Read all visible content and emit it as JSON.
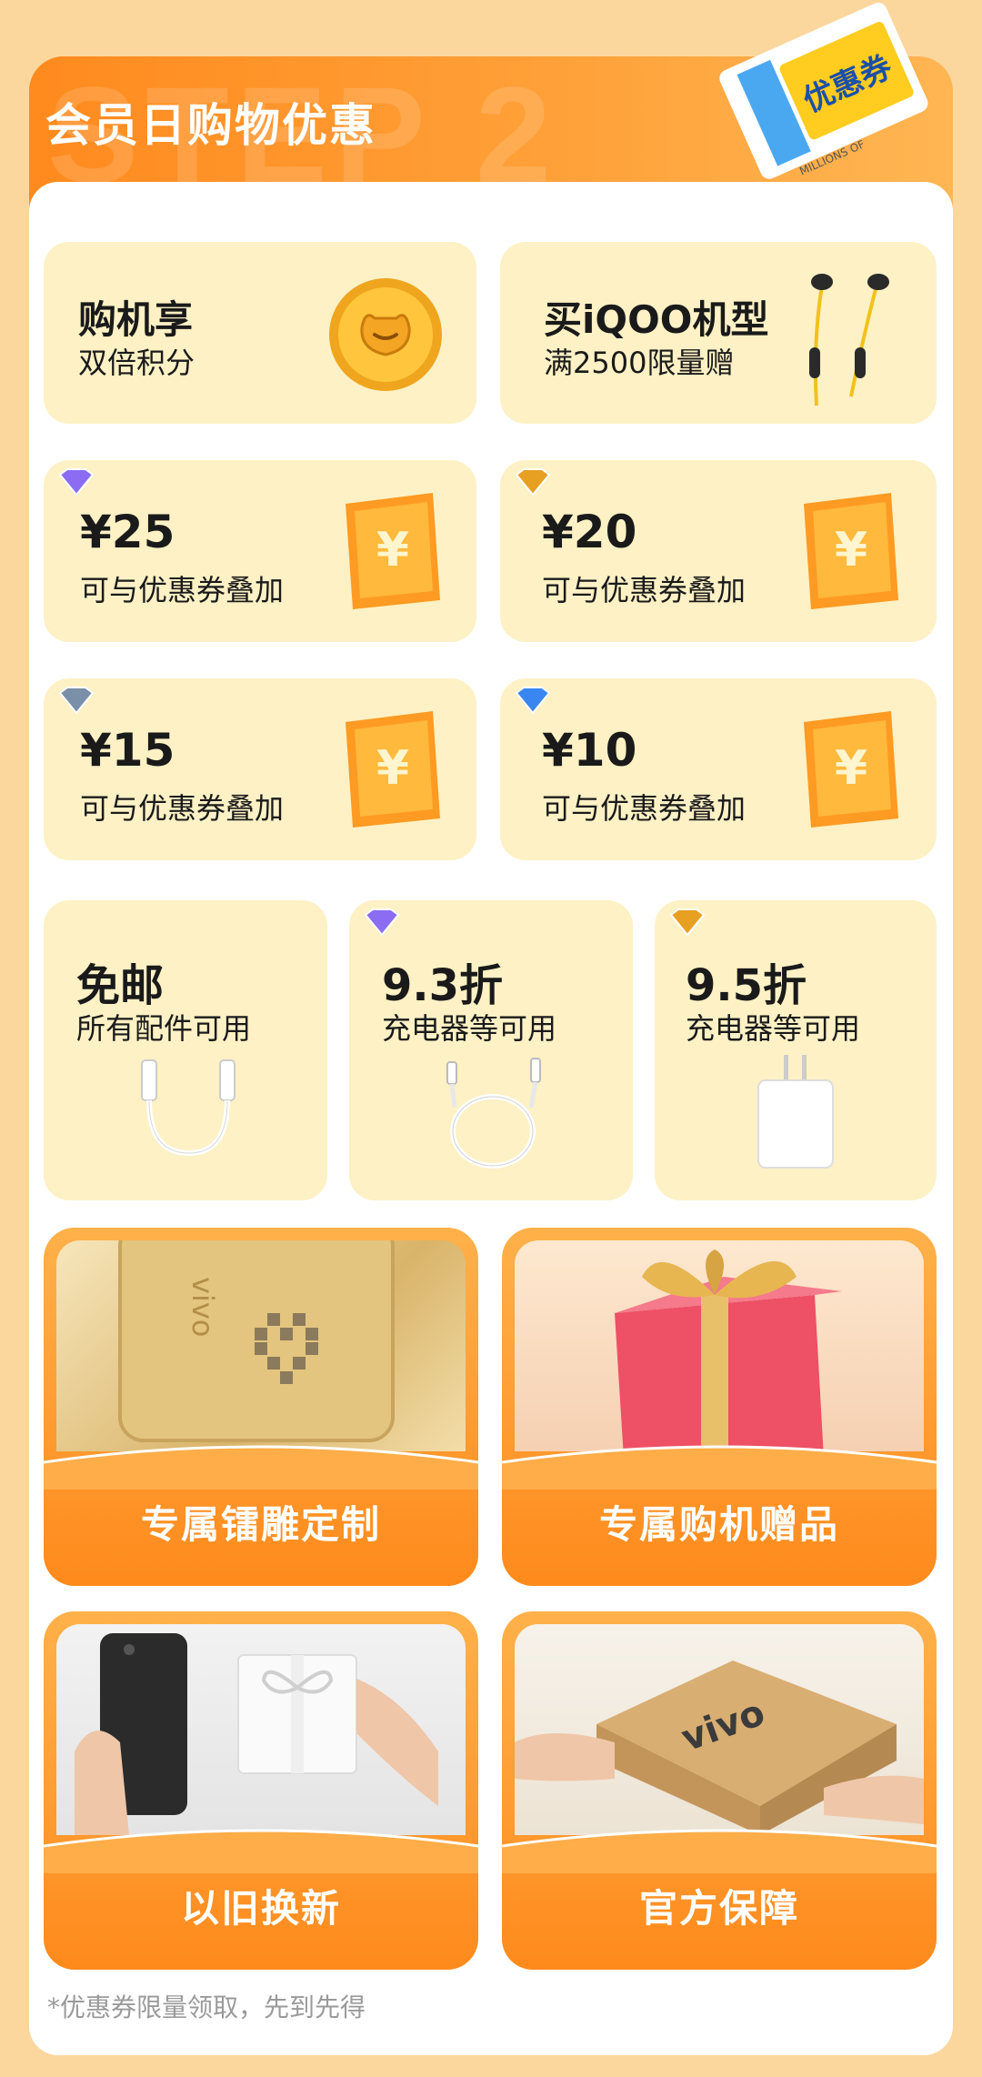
{
  "header": {
    "watermark": "STEP 2",
    "title": "会员日购物优惠",
    "ticket_text": "优惠券",
    "ticket_small": "MILLIONS OF"
  },
  "row1": [
    {
      "title": "购机享",
      "sub": "双倍积分",
      "icon": "gold-coin-icon"
    },
    {
      "title": "买iQOO机型",
      "sub": "满2500限量赠",
      "icon": "earphones-icon"
    }
  ],
  "coupons": [
    {
      "amount": "¥25",
      "sub": "可与优惠券叠加",
      "tier_color": "#8b6cf2"
    },
    {
      "amount": "¥20",
      "sub": "可与优惠券叠加",
      "tier_color": "#e8a022"
    },
    {
      "amount": "¥15",
      "sub": "可与优惠券叠加",
      "tier_color": "#7a8fa8"
    },
    {
      "amount": "¥10",
      "sub": "可与优惠券叠加",
      "tier_color": "#3a86f0"
    }
  ],
  "accessories": [
    {
      "title": "免邮",
      "sub": "所有配件可用",
      "icon": "usb-adapter-icon"
    },
    {
      "title": "9.3折",
      "sub": "充电器等可用",
      "icon": "cable-icon",
      "tier_color": "#8b6cf2"
    },
    {
      "title": "9.5折",
      "sub": "充电器等可用",
      "icon": "charger-icon",
      "tier_color": "#e8a022"
    }
  ],
  "features": [
    {
      "label": "专属镭雕定制"
    },
    {
      "label": "专属购机赠品"
    },
    {
      "label": "以旧换新"
    },
    {
      "label": "官方保障"
    }
  ],
  "footnote": "*优惠券限量领取，先到先得",
  "colors": {
    "accent": "#ff8a1e",
    "card_bg": "#fdf1c5",
    "page_bg": "#fbd79e"
  }
}
